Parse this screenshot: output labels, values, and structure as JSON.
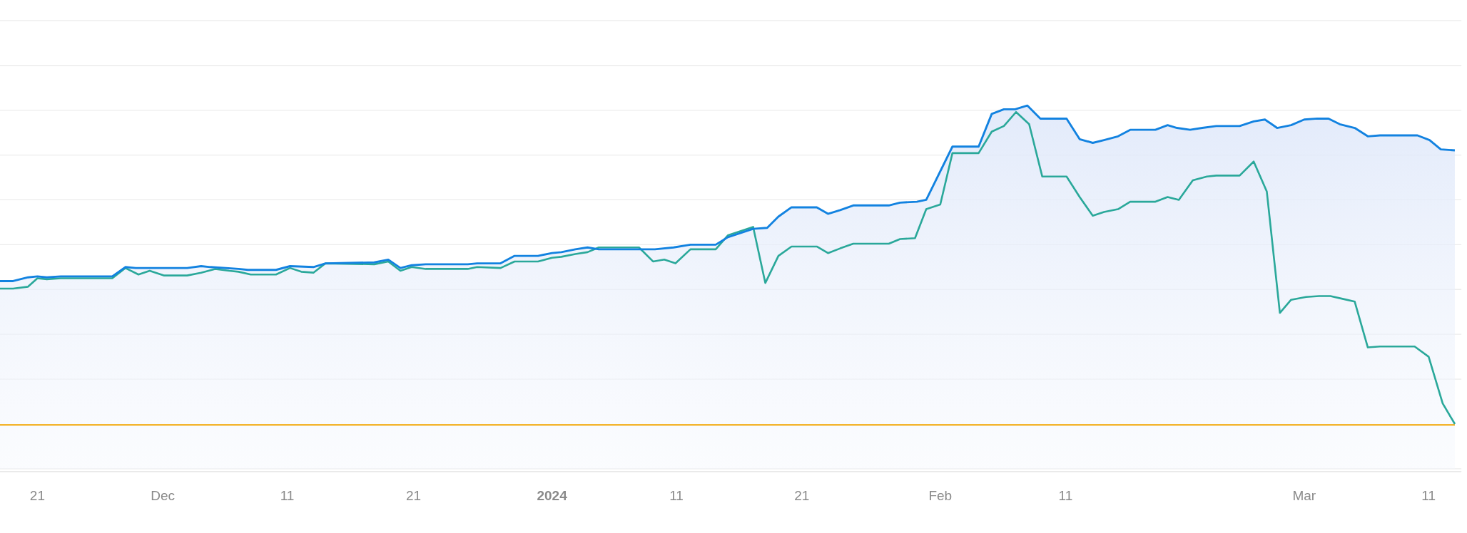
{
  "x_axis": {
    "labels": [
      {
        "text": "21",
        "kind": "day"
      },
      {
        "text": "Dec",
        "kind": "month"
      },
      {
        "text": "11",
        "kind": "day"
      },
      {
        "text": "21",
        "kind": "day"
      },
      {
        "text": "2024",
        "kind": "year"
      },
      {
        "text": "11",
        "kind": "day"
      },
      {
        "text": "21",
        "kind": "day"
      },
      {
        "text": "Feb",
        "kind": "month"
      },
      {
        "text": "11",
        "kind": "day"
      },
      {
        "text": "Mar",
        "kind": "month"
      },
      {
        "text": "11",
        "kind": "day"
      }
    ]
  }
}
